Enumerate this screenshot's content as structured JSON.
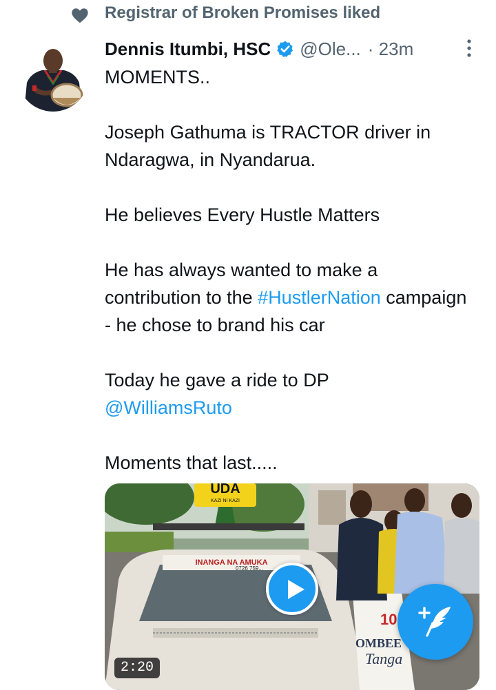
{
  "social_context": {
    "text": "Registrar of Broken Promises liked",
    "icon": "heart-icon"
  },
  "tweet": {
    "author_name": "Dennis Itumbi, HSC",
    "verified": true,
    "handle": "@Ole...",
    "time": "· 23m",
    "lines": [
      "MOMENTS..",
      "Joseph Gathuma is TRACTOR driver in Ndaragwa, in Nyandarua.",
      "He believes Every Hustle Matters",
      "He has always wanted to make a contribution to the",
      "#HustlerNation",
      "campaign - he chose to brand his car",
      "Today he gave a ride to DP",
      "@WilliamsRuto",
      "Moments that last....."
    ],
    "media": {
      "type": "video",
      "duration": "2:20",
      "sign_text": "UDA",
      "sign_subtext": "KAZI NI KAZI",
      "windshield_text": "INANGA NA AMUKA",
      "windshield_phone": "0726 759...",
      "car_text_1": "OMBEE",
      "car_text_2": "Tanga",
      "car_number": "10"
    }
  },
  "colors": {
    "accent": "#1d9bf0",
    "text": "#0f1419",
    "secondary": "#536471"
  },
  "icons": {
    "verified": "verified-badge-icon",
    "more": "more-vertical-icon",
    "play": "play-icon",
    "compose": "compose-tweet-icon"
  }
}
